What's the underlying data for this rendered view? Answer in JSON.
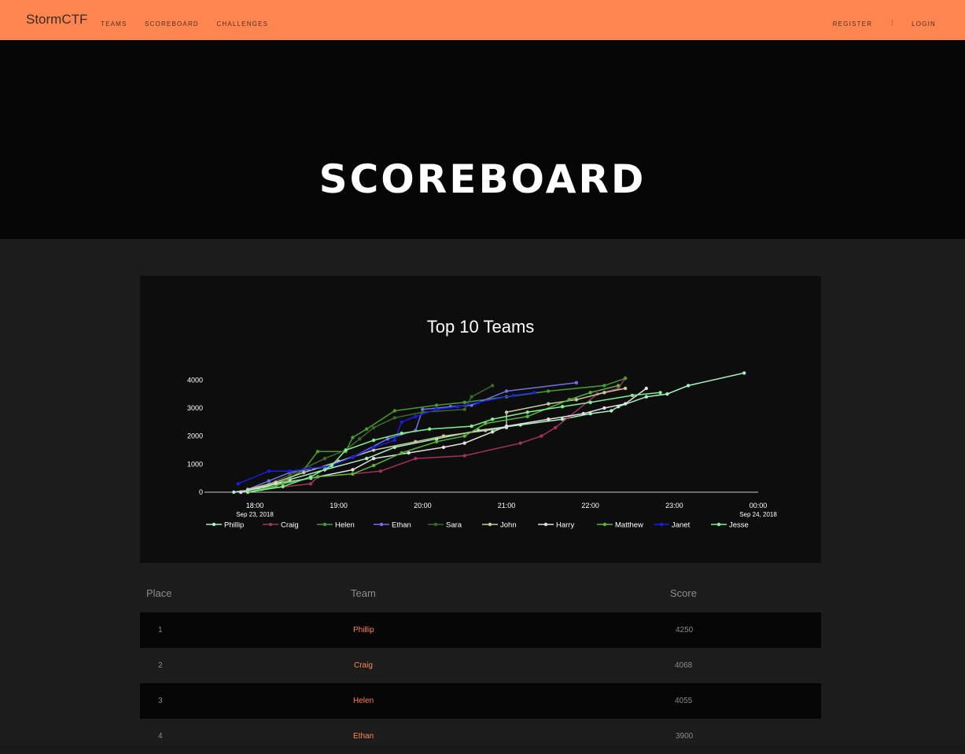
{
  "navbar": {
    "brand": "StormCTF",
    "links": [
      "TEAMS",
      "SCOREBOARD",
      "CHALLENGES"
    ],
    "register": "REGISTER",
    "login": "LOGIN"
  },
  "jumbotron": {
    "title": "SCOREBOARD"
  },
  "chart_data": {
    "type": "line",
    "title": "Top 10 Teams",
    "x_type": "datetime",
    "xlim": [
      "2018-09-23 17:24",
      "2018-09-24 00:00"
    ],
    "ylim": [
      0,
      4400
    ],
    "yticks": [
      0,
      1000,
      2000,
      3000,
      4000
    ],
    "xticks": [
      {
        "t": "2018-09-23 18:00",
        "label": "18:00",
        "sub": "Sep 23, 2018"
      },
      {
        "t": "2018-09-23 19:00",
        "label": "19:00",
        "sub": ""
      },
      {
        "t": "2018-09-23 20:00",
        "label": "20:00",
        "sub": ""
      },
      {
        "t": "2018-09-23 21:00",
        "label": "21:00",
        "sub": ""
      },
      {
        "t": "2018-09-23 22:00",
        "label": "22:00",
        "sub": ""
      },
      {
        "t": "2018-09-23 23:00",
        "label": "23:00",
        "sub": ""
      },
      {
        "t": "2018-09-24 00:00",
        "label": "00:00",
        "sub": "Sep 24, 2018"
      }
    ],
    "legend_position": "bottom",
    "series": [
      {
        "name": "Phillip",
        "color": "#a8f0c0",
        "points": [
          [
            "17:45",
            0
          ],
          [
            "18:05",
            150
          ],
          [
            "18:25",
            450
          ],
          [
            "18:50",
            800
          ],
          [
            "19:20",
            1200
          ],
          [
            "19:40",
            1600
          ],
          [
            "20:10",
            1900
          ],
          [
            "20:40",
            2200
          ],
          [
            "21:10",
            2400
          ],
          [
            "21:40",
            2600
          ],
          [
            "22:00",
            2800
          ],
          [
            "22:15",
            2900
          ],
          [
            "22:20",
            3050
          ],
          [
            "22:40",
            3400
          ],
          [
            "22:55",
            3500
          ],
          [
            "23:10",
            3800
          ],
          [
            "23:50",
            4250
          ]
        ]
      },
      {
        "name": "Craig",
        "color": "#a0335e",
        "points": [
          [
            "18:05",
            100
          ],
          [
            "18:40",
            300
          ],
          [
            "18:45",
            550
          ],
          [
            "19:10",
            650
          ],
          [
            "19:30",
            750
          ],
          [
            "19:55",
            1200
          ],
          [
            "20:30",
            1300
          ],
          [
            "21:10",
            1750
          ],
          [
            "21:25",
            2000
          ],
          [
            "21:35",
            2300
          ],
          [
            "21:45",
            2700
          ],
          [
            "22:05",
            3500
          ],
          [
            "22:20",
            3700
          ],
          [
            "22:25",
            4068
          ]
        ]
      },
      {
        "name": "Helen",
        "color": "#4a9a30",
        "points": [
          [
            "17:55",
            0
          ],
          [
            "18:15",
            200
          ],
          [
            "18:35",
            800
          ],
          [
            "18:45",
            1450
          ],
          [
            "19:05",
            1450
          ],
          [
            "19:10",
            1950
          ],
          [
            "19:20",
            2250
          ],
          [
            "19:40",
            2900
          ],
          [
            "20:10",
            3100
          ],
          [
            "20:30",
            3200
          ],
          [
            "21:00",
            3400
          ],
          [
            "21:30",
            3600
          ],
          [
            "22:10",
            3800
          ],
          [
            "22:25",
            4055
          ]
        ]
      },
      {
        "name": "Ethan",
        "color": "#7070e8",
        "points": [
          [
            "17:50",
            0
          ],
          [
            "18:10",
            400
          ],
          [
            "18:25",
            700
          ],
          [
            "18:50",
            900
          ],
          [
            "19:10",
            1250
          ],
          [
            "19:35",
            1900
          ],
          [
            "19:55",
            2200
          ],
          [
            "20:00",
            2950
          ],
          [
            "20:20",
            3050
          ],
          [
            "20:35",
            3100
          ],
          [
            "21:00",
            3600
          ],
          [
            "21:50",
            3900
          ]
        ]
      },
      {
        "name": "Sara",
        "color": "#3a6a28",
        "points": [
          [
            "17:50",
            0
          ],
          [
            "18:10",
            300
          ],
          [
            "18:25",
            600
          ],
          [
            "18:50",
            1200
          ],
          [
            "19:05",
            1500
          ],
          [
            "19:15",
            1900
          ],
          [
            "19:25",
            2300
          ],
          [
            "19:40",
            2650
          ],
          [
            "20:00",
            2850
          ],
          [
            "20:30",
            2950
          ],
          [
            "20:35",
            3400
          ],
          [
            "20:50",
            3800
          ]
        ]
      },
      {
        "name": "John",
        "color": "#c8c8a0",
        "points": [
          [
            "17:55",
            100
          ],
          [
            "18:15",
            350
          ],
          [
            "18:35",
            700
          ],
          [
            "19:00",
            1100
          ],
          [
            "19:25",
            1500
          ],
          [
            "19:55",
            1800
          ],
          [
            "20:15",
            2000
          ],
          [
            "20:45",
            2200
          ],
          [
            "21:00",
            2300
          ],
          [
            "21:00",
            2850
          ],
          [
            "21:30",
            3150
          ],
          [
            "21:50",
            3300
          ],
          [
            "22:10",
            3550
          ],
          [
            "22:25",
            3700
          ]
        ]
      },
      {
        "name": "Harry",
        "color": "#e0e0e0",
        "points": [
          [
            "17:50",
            0
          ],
          [
            "18:15",
            300
          ],
          [
            "18:40",
            500
          ],
          [
            "19:10",
            800
          ],
          [
            "19:25",
            1200
          ],
          [
            "19:50",
            1400
          ],
          [
            "20:15",
            1600
          ],
          [
            "20:30",
            1750
          ],
          [
            "20:50",
            2150
          ],
          [
            "21:00",
            2350
          ],
          [
            "21:30",
            2600
          ],
          [
            "21:55",
            2800
          ],
          [
            "22:10",
            3000
          ],
          [
            "22:25",
            3150
          ],
          [
            "22:40",
            3700
          ]
        ]
      },
      {
        "name": "Matthew",
        "color": "#58b838",
        "points": [
          [
            "17:55",
            0
          ],
          [
            "18:20",
            300
          ],
          [
            "18:45",
            550
          ],
          [
            "19:10",
            650
          ],
          [
            "19:25",
            950
          ],
          [
            "19:45",
            1400
          ],
          [
            "20:10",
            1800
          ],
          [
            "20:30",
            2000
          ],
          [
            "20:45",
            2450
          ],
          [
            "21:15",
            2700
          ],
          [
            "21:45",
            3300
          ],
          [
            "22:00",
            3550
          ],
          [
            "22:20",
            3800
          ]
        ]
      },
      {
        "name": "Janet",
        "color": "#1820e0",
        "points": [
          [
            "17:48",
            300
          ],
          [
            "18:10",
            750
          ],
          [
            "18:25",
            750
          ],
          [
            "18:40",
            850
          ],
          [
            "18:55",
            950
          ],
          [
            "19:10",
            1250
          ],
          [
            "19:25",
            1600
          ],
          [
            "19:40",
            1850
          ],
          [
            "19:45",
            2500
          ],
          [
            "19:55",
            2700
          ],
          [
            "20:10",
            2950
          ],
          [
            "20:25",
            3050
          ],
          [
            "20:40",
            3200
          ],
          [
            "21:05",
            3450
          ],
          [
            "21:20",
            3550
          ]
        ]
      },
      {
        "name": "Jesse",
        "color": "#80f090",
        "points": [
          [
            "17:55",
            0
          ],
          [
            "18:20",
            200
          ],
          [
            "18:40",
            550
          ],
          [
            "18:55",
            950
          ],
          [
            "19:05",
            1500
          ],
          [
            "19:25",
            1850
          ],
          [
            "19:45",
            2100
          ],
          [
            "20:05",
            2250
          ],
          [
            "20:35",
            2350
          ],
          [
            "20:50",
            2600
          ],
          [
            "21:15",
            2850
          ],
          [
            "21:40",
            3050
          ],
          [
            "22:00",
            3200
          ],
          [
            "22:30",
            3450
          ],
          [
            "22:50",
            3550
          ]
        ]
      }
    ]
  },
  "table": {
    "headers": {
      "place": "Place",
      "team": "Team",
      "score": "Score"
    },
    "rows": [
      {
        "place": "1",
        "team": "Phillip",
        "score": "4250"
      },
      {
        "place": "2",
        "team": "Craig",
        "score": "4068"
      },
      {
        "place": "3",
        "team": "Helen",
        "score": "4055"
      },
      {
        "place": "4",
        "team": "Ethan",
        "score": "3900"
      }
    ]
  }
}
